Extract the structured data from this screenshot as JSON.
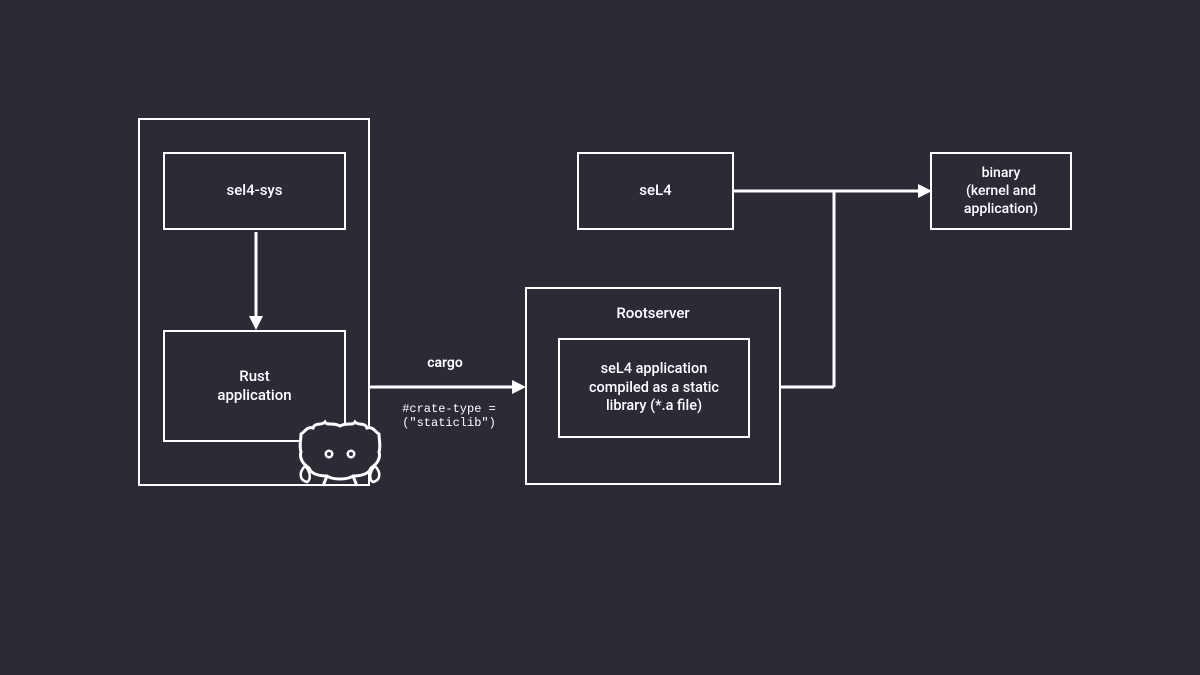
{
  "boxes": {
    "sel4sys": "sel4-sys",
    "rustapp": "Rust\napplication",
    "sel4": "seL4",
    "binary": "binary\n(kernel and\napplication)",
    "staticlib": "seL4 application\ncompiled as a static\nlibrary (*.a file)"
  },
  "labels": {
    "cargo": "cargo",
    "crate_type": "#crate-type =\n(\"staticlib\")",
    "rootserver": "Rootserver"
  }
}
